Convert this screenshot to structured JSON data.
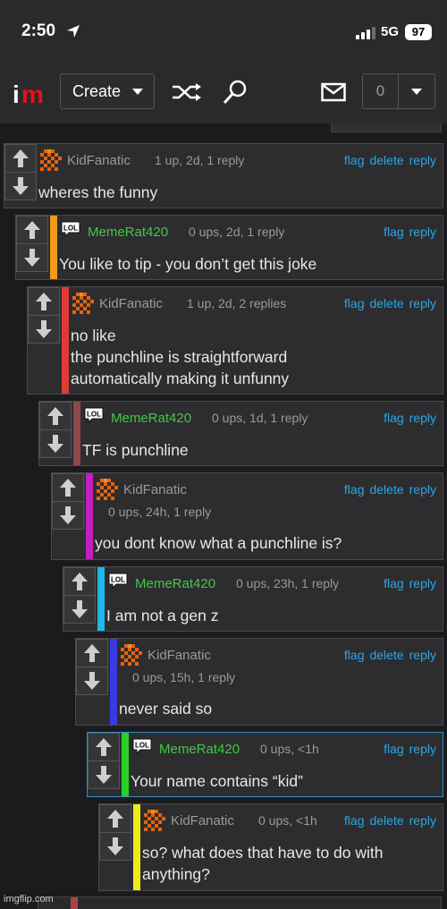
{
  "status_bar": {
    "time": "2:50",
    "network": "5G",
    "battery": "97"
  },
  "header": {
    "create_label": "Create",
    "notification_count": "0"
  },
  "comments": [
    {
      "user": "KidFanatic",
      "meta": "1 up, 2d, 1 reply",
      "actions": [
        "flag",
        "delete",
        "reply"
      ],
      "lines": [
        "wheres the funny"
      ],
      "depth_color": ""
    },
    {
      "user": "MemeRat420",
      "meta": "0 ups, 2d, 1 reply",
      "actions": [
        "flag",
        "reply"
      ],
      "lines": [
        "You like to tip - you don’t get this joke"
      ],
      "depth_color": "#f39a17"
    },
    {
      "user": "KidFanatic",
      "meta": "1 up, 2d, 2 replies",
      "actions": [
        "flag",
        "delete",
        "reply"
      ],
      "lines": [
        "no like",
        "the punchline is straightforward",
        "automatically making it unfunny"
      ],
      "depth_color": "#e03a3a"
    },
    {
      "user": "MemeRat420",
      "meta": "0 ups, 1d, 1 reply",
      "actions": [
        "flag",
        "reply"
      ],
      "lines": [
        "TF is punchline"
      ],
      "depth_color": "#8c4a4a"
    },
    {
      "user": "KidFanatic",
      "meta": "0 ups, 24h, 1 reply",
      "actions": [
        "flag",
        "delete",
        "reply"
      ],
      "lines": [
        "you dont know what a punchline is?"
      ],
      "depth_color": "#c21fc2"
    },
    {
      "user": "MemeRat420",
      "meta": "0 ups, 23h, 1 reply",
      "actions": [
        "flag",
        "reply"
      ],
      "lines": [
        "I am not a gen z"
      ],
      "depth_color": "#21b7e8"
    },
    {
      "user": "KidFanatic",
      "meta": "0 ups, 15h, 1 reply",
      "actions": [
        "flag",
        "delete",
        "reply"
      ],
      "lines": [
        "never said so"
      ],
      "depth_color": "#3a3ae0"
    },
    {
      "user": "MemeRat420",
      "meta": "0 ups, <1h",
      "actions": [
        "flag",
        "reply"
      ],
      "lines": [
        "Your name contains “kid”"
      ],
      "depth_color": "#27d127"
    },
    {
      "user": "KidFanatic",
      "meta": "0 ups, <1h",
      "actions": [
        "flag",
        "delete",
        "reply"
      ],
      "lines": [
        "so? what does that have to do with",
        "anything?"
      ],
      "depth_color": "#ecec1a"
    }
  ],
  "watermark": "imgflip.com",
  "colors": {
    "background": "#1b1b1d",
    "panel": "#2d2d2f",
    "link": "#28a7e8",
    "username_green": "#42c846",
    "logo_red": "#e8101c"
  }
}
